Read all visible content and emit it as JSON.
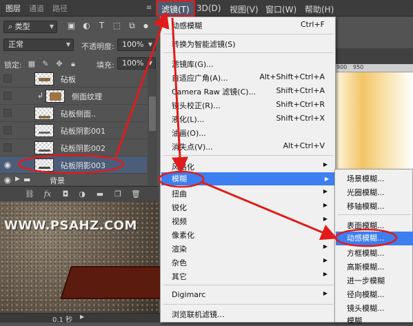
{
  "layers_panel": {
    "tabs": [
      "图层",
      "通道",
      "路径"
    ],
    "filter_kind": "类型",
    "blend_mode": "正常",
    "opacity_label": "不透明度:",
    "opacity_value": "100%",
    "lock_label": "锁定:",
    "fill_label": "填充:",
    "fill_value": "100%",
    "layers": [
      {
        "name": "砧板",
        "visible": false,
        "selected": false
      },
      {
        "name": "侧面纹理",
        "visible": false,
        "selected": false
      },
      {
        "name": "砧板侧面..",
        "visible": false,
        "selected": false
      },
      {
        "name": "砧板阴影001",
        "visible": false,
        "selected": false
      },
      {
        "name": "砧板阴影002",
        "visible": false,
        "selected": false
      },
      {
        "name": "砧板阴影003",
        "visible": true,
        "selected": true
      },
      {
        "name": "背景",
        "visible": true,
        "selected": false
      }
    ]
  },
  "watermark": "WWW.PSAHZ.COM",
  "status": {
    "time": "0.1 秒"
  },
  "menubar": {
    "items": [
      "滤镜(T)",
      "3D(D)",
      "视图(V)",
      "窗口(W)",
      "帮助(H)"
    ],
    "active": "滤镜(T)"
  },
  "ruler": {
    "ticks": [
      "900",
      "950"
    ]
  },
  "filter_menu": {
    "last_filter": {
      "label": "动感模糊",
      "shortcut": "Ctrl+F"
    },
    "convert_smart": "转换为智能滤镜(S)",
    "gallery": "滤镜库(G)...",
    "adaptive_wide": {
      "label": "自适应广角(A)...",
      "shortcut": "Alt+Shift+Ctrl+A"
    },
    "camera_raw": {
      "label": "Camera Raw 滤镜(C)...",
      "shortcut": "Shift+Ctrl+A"
    },
    "lens_correction": {
      "label": "镜头校正(R)...",
      "shortcut": "Shift+Ctrl+R"
    },
    "liquify": {
      "label": "液化(L)...",
      "shortcut": "Shift+Ctrl+X"
    },
    "oil_paint": "油画(O)...",
    "vanishing_point": {
      "label": "消失点(V)...",
      "shortcut": "Alt+Ctrl+V"
    },
    "stylize": "风格化",
    "blur": "模糊",
    "distort": "扭曲",
    "sharpen": "锐化",
    "video": "视频",
    "pixelate": "像素化",
    "render": "渲染",
    "noise": "杂色",
    "other": "其它",
    "digimarc": "Digimarc",
    "browse_online": "浏览联机滤镜..."
  },
  "blur_submenu": {
    "items": [
      "场景模糊...",
      "光圈模糊...",
      "移轴模糊...",
      "表面模糊...",
      "动感模糊...",
      "方框模糊...",
      "高斯模糊...",
      "进一步模糊",
      "径向模糊...",
      "镜头模糊...",
      "模糊"
    ],
    "highlighted": "动感模糊..."
  },
  "colors": {
    "menu_highlight": "#3d7ef0",
    "annotation_red": "#e11b1b",
    "layer_selected": "#4b5d78"
  }
}
